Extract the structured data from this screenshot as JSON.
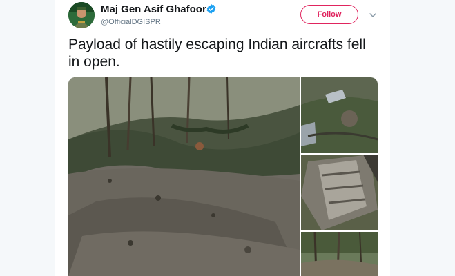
{
  "tweet": {
    "author": {
      "name": "Maj Gen Asif Ghafoor",
      "handle": "@OfficialDGISPR",
      "verified": true,
      "avatar_icon": "profile-photo"
    },
    "follow_label": "Follow",
    "text": "Payload of hastily escaping Indian aircrafts fell in open.",
    "more_icon": "chevron-down-icon",
    "media_count": 4
  },
  "colors": {
    "accent": "#e0245e",
    "verified": "#1da1f2",
    "text_primary": "#14171a",
    "text_secondary": "#657786"
  }
}
